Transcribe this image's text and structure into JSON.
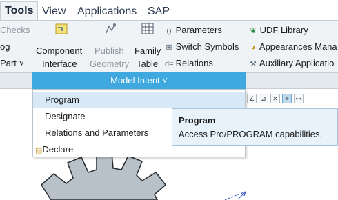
{
  "tabs": [
    "Tools",
    "View",
    "Applications",
    "SAP"
  ],
  "ribbon": {
    "left_partial": [
      "Checks",
      "og",
      "Part ˅"
    ],
    "component_interface": [
      "Component",
      "Interface"
    ],
    "publish_geometry": [
      "Publish",
      "Geometry"
    ],
    "family_table": [
      "Family",
      "Table"
    ],
    "middle_column": [
      "Parameters",
      "Switch Symbols",
      "Relations"
    ],
    "right_column": [
      "UDF Library",
      "Appearances Mana",
      "Auxiliary Applicatio"
    ]
  },
  "group_label": "Model Intent ˅",
  "dropdown": {
    "items": [
      "Program",
      "Designate",
      "Relations and Parameters",
      "Declare"
    ],
    "highlighted": "Program"
  },
  "tooltip": {
    "title": "Program",
    "description": "Access Pro/PROGRAM capabilities."
  },
  "colors": {
    "accent": "#3fa9df",
    "highlight": "#d7e9f6",
    "tooltip_bg": "#e8f2fa",
    "ribbon_bg": "#f0f3f6",
    "gear_fill": "#b9c1c8"
  },
  "icons": [
    "component-interface-icon",
    "publish-geometry-icon",
    "family-table-icon",
    "parameters-icon",
    "switch-symbols-icon",
    "relations-icon",
    "udf-library-icon",
    "appearances-icon",
    "auxiliary-applications-icon",
    "declare-icon"
  ]
}
